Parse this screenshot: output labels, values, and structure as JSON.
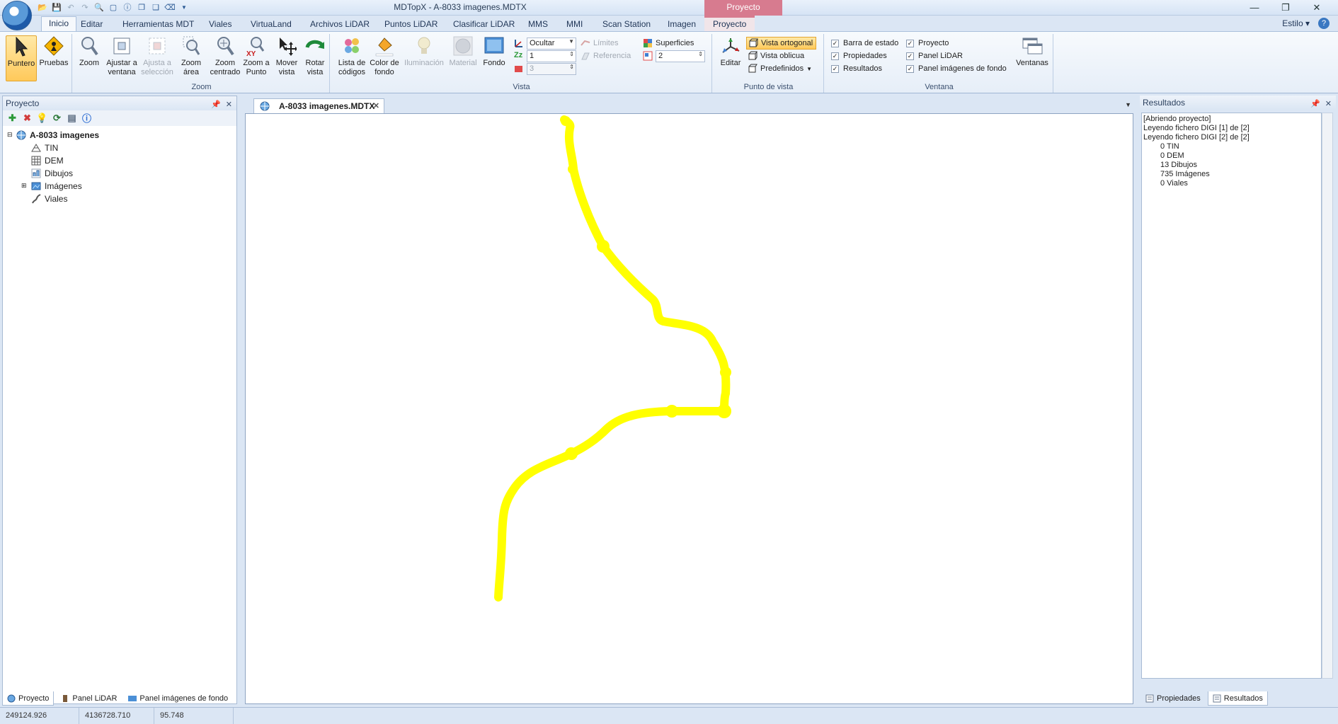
{
  "window": {
    "title": "MDTopX - A-8033 imagenes.MDTX",
    "context_tab_header": "Proyecto",
    "controls": [
      "—",
      "❐",
      "✕"
    ]
  },
  "tabs": [
    "Inicio",
    "Editar",
    "Herramientas MDT",
    "Viales",
    "VirtuaLand",
    "Archivos LiDAR",
    "Puntos LiDAR",
    "Clasificar LiDAR",
    "MMS",
    "MMI",
    "Scan Station",
    "Imagen",
    "Proyecto"
  ],
  "estilo_label": "Estilo",
  "ribbon": {
    "puntero": "Puntero",
    "pruebas": "Pruebas",
    "zoom_group": {
      "label": "Zoom",
      "buttons": [
        "Zoom",
        "Ajustar a ventana",
        "Ajusta a selección",
        "Zoom área",
        "Zoom centrado",
        "Zoom a Punto",
        "Mover vista",
        "Rotar vista"
      ]
    },
    "vista_group": {
      "label": "Vista",
      "buttons": [
        "Lista de códigos",
        "Color de fondo",
        "Iluminación",
        "Material",
        "Fondo"
      ],
      "ocultar": "Ocultar",
      "zz_value": "1",
      "red_value": "3",
      "limites": "Límites",
      "referencia": "Referencia",
      "superficies": "Superficies",
      "sup_value": "2"
    },
    "punto_vista_group": {
      "label": "Punto de vista",
      "editar": "Editar",
      "vista_ortogonal": "Vista ortogonal",
      "vista_oblicua": "Vista oblicua",
      "predefinidos": "Predefinidos"
    },
    "ventana_group": {
      "label": "Ventana",
      "checks_left": [
        "Barra de estado",
        "Propiedades",
        "Resultados"
      ],
      "checks_right": [
        "Proyecto",
        "Panel LiDAR",
        "Panel imágenes de fondo"
      ],
      "ventanas": "Ventanas"
    }
  },
  "project_panel": {
    "title": "Proyecto",
    "root": "A-8033 imagenes",
    "items": [
      "TIN",
      "DEM",
      "Dibujos",
      "Imágenes",
      "Viales"
    ],
    "bottom_tabs": [
      "Proyecto",
      "Panel LiDAR",
      "Panel imágenes de fondo"
    ]
  },
  "document": {
    "tab_title": "A-8033 imagenes.MDTX",
    "line_color": "#ffff00"
  },
  "results_panel": {
    "title": "Resultados",
    "lines": [
      "[Abriendo proyecto]",
      "Leyendo fichero DIGI [1] de [2]",
      "Leyendo fichero DIGI [2] de [2]"
    ],
    "indented_lines": [
      "0 TIN",
      "0 DEM",
      "13 Dibujos",
      "735 Imágenes",
      "0 Viales"
    ],
    "bottom_tabs": [
      "Propiedades",
      "Resultados"
    ]
  },
  "status": [
    "249124.926",
    "4136728.710",
    "95.748"
  ],
  "colors": {
    "ribbon_bg": "#e6eef8",
    "active_button": "#ffc95a",
    "context_tab": "#d77b8f",
    "accent": "#3a78c2"
  }
}
